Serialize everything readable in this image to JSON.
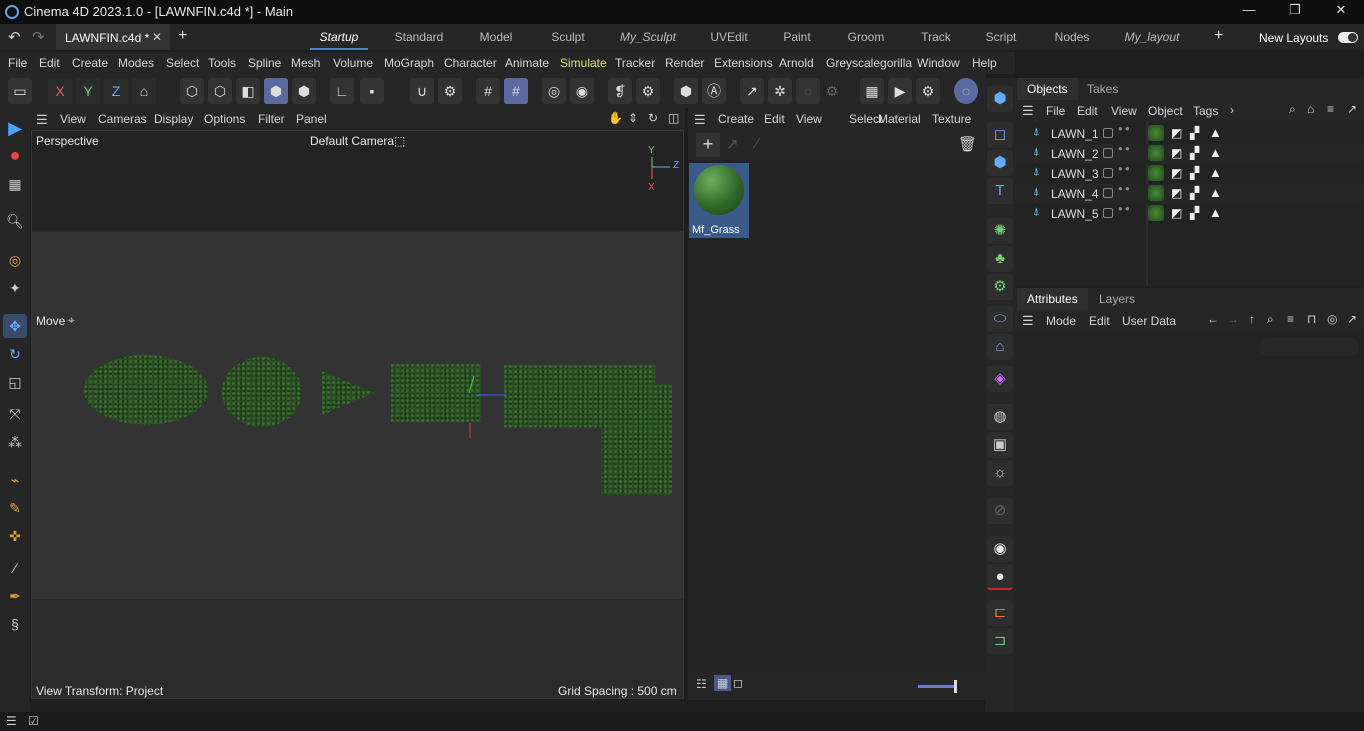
{
  "titlebar": {
    "title": "Cinema 4D 2023.1.0 - [LAWNFIN.c4d *] - Main",
    "minimize": "—",
    "restore": "❐",
    "close": "✕"
  },
  "doc_tab": {
    "label": "LAWNFIN.c4d *",
    "close": "✕",
    "add": "+"
  },
  "layouts": [
    "Startup",
    "Standard",
    "Model",
    "Sculpt",
    "My_Sculpt",
    "UVEdit",
    "Paint",
    "Groom",
    "Track",
    "Script",
    "Nodes",
    "My_layout"
  ],
  "layout_add": "+",
  "new_layouts": "New Layouts",
  "menu": [
    "File",
    "Edit",
    "Create",
    "Modes",
    "Select",
    "Tools",
    "Spline",
    "Mesh",
    "Volume",
    "MoGraph",
    "Character",
    "Animate",
    "Simulate",
    "Tracker",
    "Render",
    "Extensions",
    "Arnold",
    "Greyscalegorilla",
    "Window",
    "Help"
  ],
  "axis": {
    "x": "X",
    "y": "Y",
    "z": "Z"
  },
  "viewport": {
    "menu": [
      "View",
      "Cameras",
      "Display",
      "Options",
      "Filter",
      "Panel"
    ],
    "view_name": "Perspective",
    "camera": "Default Camera",
    "move_label": "Move",
    "bottom_left": "View Transform: Project",
    "bottom_right": "Grid Spacing : 500 cm",
    "gizmo": {
      "y": "Y",
      "z": "Z",
      "x": "X"
    }
  },
  "material": {
    "menu": [
      "Create",
      "Edit",
      "View",
      "Select",
      "Material",
      "Texture"
    ],
    "name": "Mf_Grass"
  },
  "objects": {
    "tabs": [
      "Objects",
      "Takes"
    ],
    "menu": [
      "File",
      "Edit",
      "View",
      "Object",
      "Tags"
    ],
    "items": [
      "LAWN_1",
      "LAWN_2",
      "LAWN_3",
      "LAWN_4",
      "LAWN_5"
    ]
  },
  "attributes": {
    "tabs": [
      "Attributes",
      "Layers"
    ],
    "menu": [
      "Mode",
      "Edit",
      "User Data"
    ]
  },
  "colors": {
    "accent": "#4a86c8",
    "simulate": "#e2e06a"
  }
}
